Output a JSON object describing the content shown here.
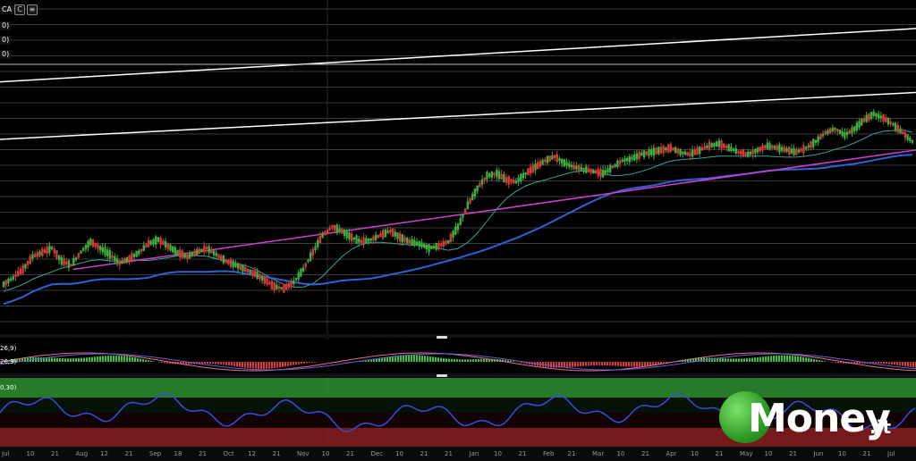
{
  "chart_info": {
    "symbol_label": "CA",
    "legend_labels": [
      "0)",
      "0)",
      "0)"
    ],
    "macd_labels": [
      "26,9)",
      "26,9)"
    ],
    "oscillator_label": "0,30)",
    "toolbar": [
      "C",
      "≡"
    ]
  },
  "brand": {
    "text": "Money",
    "suffix": ".it"
  },
  "colors": {
    "background": "#000000",
    "grid": "#3a3a3a",
    "candle_up": "#3fae3f",
    "candle_down": "#d33a3a",
    "ma_fast": "#35a39a",
    "ma_slow": "#2e62d6",
    "trend_magenta": "#d040d0",
    "channel": "#ffffff",
    "osc_line": "#3a4be0",
    "osc_upper_zone": "#2e8f2e",
    "osc_lower_zone": "#8a1f1f",
    "macd_signal": "#6a5fd6",
    "macd_hist_pos": "#38c438",
    "macd_hist_neg": "#d63838"
  },
  "chart_data": {
    "type": "line",
    "title": "",
    "xlabel": "",
    "ylabel": "",
    "x_ticks": [
      "Jul",
      "10",
      "21",
      "Aug",
      "12",
      "21",
      "Sep",
      "18",
      "21",
      "Oct",
      "12",
      "21",
      "Nov",
      "10",
      "21",
      "Dec",
      "10",
      "21",
      "21",
      "Jan",
      "10",
      "21",
      "Feb",
      "21",
      "Mar",
      "10",
      "21",
      "Apr",
      "10",
      "21",
      "May",
      "10",
      "21",
      "Jun",
      "10",
      "21",
      "Jul"
    ],
    "price_series": [
      0.35,
      0.38,
      0.42,
      0.48,
      0.5,
      0.52,
      0.46,
      0.44,
      0.5,
      0.55,
      0.52,
      0.49,
      0.45,
      0.47,
      0.5,
      0.54,
      0.56,
      0.53,
      0.5,
      0.48,
      0.5,
      0.52,
      0.49,
      0.46,
      0.44,
      0.42,
      0.4,
      0.37,
      0.34,
      0.33,
      0.36,
      0.42,
      0.5,
      0.58,
      0.62,
      0.6,
      0.57,
      0.55,
      0.56,
      0.58,
      0.6,
      0.57,
      0.55,
      0.54,
      0.52,
      0.53,
      0.55,
      0.62,
      0.72,
      0.8,
      0.86,
      0.87,
      0.84,
      0.83,
      0.87,
      0.9,
      0.93,
      0.95,
      0.92,
      0.9,
      0.89,
      0.88,
      0.87,
      0.9,
      0.93,
      0.94,
      0.96,
      0.97,
      0.98,
      0.99,
      0.97,
      0.96,
      0.98,
      1.0,
      1.01,
      0.99,
      0.97,
      0.96,
      0.98,
      1.0,
      0.99,
      0.98,
      0.97,
      0.99,
      1.02,
      1.06,
      1.08,
      1.05,
      1.08,
      1.12,
      1.15,
      1.13,
      1.1,
      1.06,
      1.02
    ],
    "trend_line_magenta": {
      "from": [
        0.08,
        0.42
      ],
      "to": [
        1.0,
        0.98
      ]
    },
    "channel_upper": {
      "from": [
        0.0,
        1.3
      ],
      "to": [
        1.0,
        1.55
      ]
    },
    "channel_lower": {
      "from": [
        0.0,
        1.03
      ],
      "to": [
        1.0,
        1.25
      ]
    },
    "legend": "top-left",
    "grid": true
  }
}
